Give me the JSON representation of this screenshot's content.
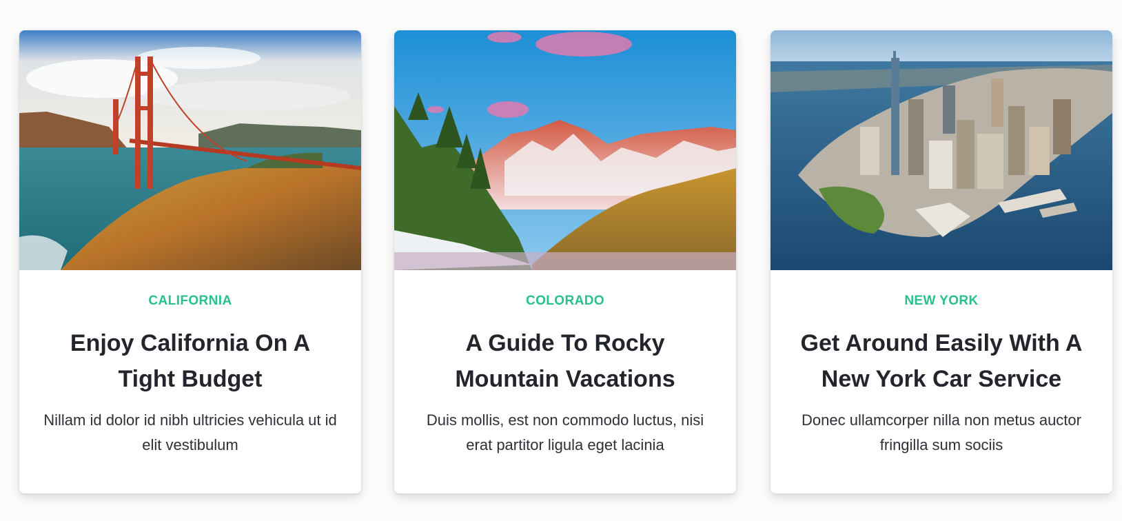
{
  "cards": [
    {
      "image_label": "california-landscape",
      "category": "CALIFORNIA",
      "title": "Enjoy California On A Tight Budget",
      "excerpt": "Nillam id dolor id nibh ultricies vehicula ut id elit vestibulum"
    },
    {
      "image_label": "colorado-mountains",
      "category": "COLORADO",
      "title": "A Guide To Rocky Mountain Vacations",
      "excerpt": "Duis mollis, est non commodo luctus, nisi erat partitor ligula eget lacinia"
    },
    {
      "image_label": "new-york-skyline",
      "category": "NEW YORK",
      "title": "Get Around Easily With A New York Car Service",
      "excerpt": "Donec ullamcorper nilla non metus auctor fringilla sum sociis"
    }
  ],
  "colors": {
    "accent": "#27c08e",
    "title": "#22252b",
    "text": "#2d3036",
    "background": "#fbfbfc"
  }
}
